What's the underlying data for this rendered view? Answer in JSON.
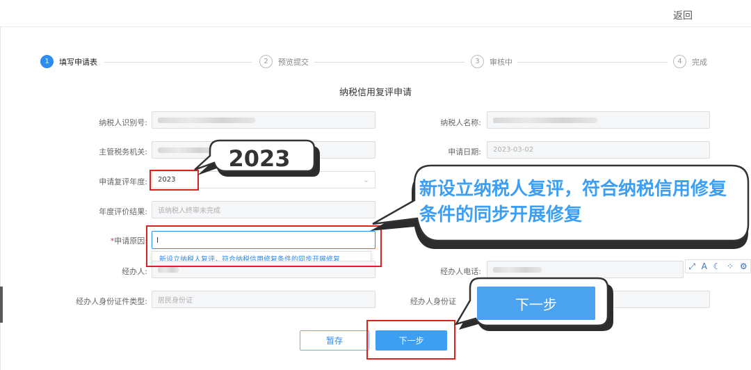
{
  "header": {
    "back_label": "返回"
  },
  "steps": [
    {
      "num": "1",
      "label": "填写申请表"
    },
    {
      "num": "2",
      "label": "预览提交"
    },
    {
      "num": "3",
      "label": "审核中"
    },
    {
      "num": "4",
      "label": "完成"
    }
  ],
  "form": {
    "title": "纳税信用复评申请",
    "taxpayer_id_label": "纳税人识别号:",
    "taxpayer_name_label": "纳税人名称:",
    "tax_authority_label": "主管税务机关:",
    "apply_date_label": "申请日期:",
    "apply_date_value": "2023-03-02",
    "review_year_label": "申请复评年度:",
    "review_year_value": "2023",
    "eval_result_label": "年度评价结果:",
    "eval_result_value": "该纳税人终审未完成",
    "reason_required_mark": "*",
    "reason_label": "申请原因:",
    "reason_value": "l",
    "reason_suggestion": "新设立纳税人复评，符合纳税信用修复条件的同步开展修复",
    "agent_label": "经办人:",
    "agent_phone_label": "经办人电话:",
    "agent_id_type_label": "经办人身份证件类型:",
    "agent_id_type_value": "居民身份证",
    "agent_id_no_label": "经办人身份证"
  },
  "buttons": {
    "save": "暂存",
    "next": "下一步"
  },
  "callouts": {
    "year": "2023",
    "reason": "新设立纳税人复评，符合纳税信用修复条件的同步开展修复",
    "next": "下一步"
  },
  "toolbar_icons": [
    "expand-icon",
    "font-icon",
    "moon-icon",
    "paint-icon",
    "gear-icon"
  ],
  "colors": {
    "accent": "#2e8bf0",
    "highlight": "#e02020",
    "callout_text": "#3d9ff3"
  }
}
